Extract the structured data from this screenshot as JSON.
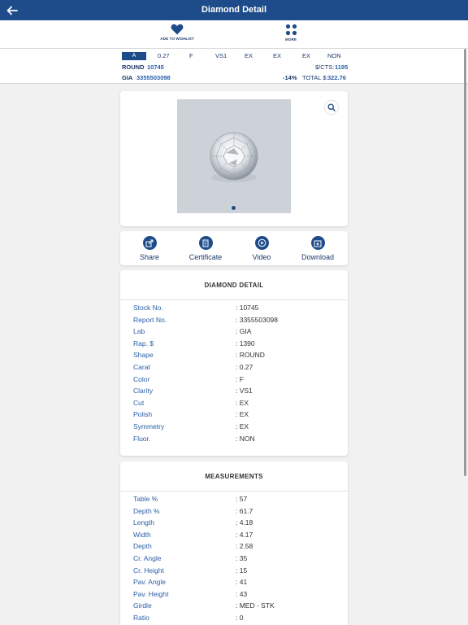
{
  "header": {
    "title": "Diamond Detail"
  },
  "actions": {
    "wishlist_label": "ADD TO WISHLIST",
    "more_label": "MORE"
  },
  "summary": {
    "grade": "A",
    "carat": "0.27",
    "color": "F",
    "clarity": "VS1",
    "cut": "EX",
    "polish": "EX",
    "symmetry": "EX",
    "fluor": "NON",
    "shape": "ROUND",
    "stock_no": "10745",
    "lab": "GIA",
    "report_no": "3355503098",
    "price_per_cts_label": "$/CTS:",
    "price_per_cts": "1195",
    "discount": "-14%",
    "total_label": "TOTAL $:",
    "total": "322.76"
  },
  "tools": [
    {
      "label": "Share"
    },
    {
      "label": "Certificate"
    },
    {
      "label": "Video"
    },
    {
      "label": "Download"
    }
  ],
  "diamond_detail": {
    "title": "DIAMOND DETAIL",
    "rows": [
      {
        "key": "Stock No.",
        "value": ": 10745"
      },
      {
        "key": "Report No.",
        "value": ": 3355503098"
      },
      {
        "key": "Lab",
        "value": ": GIA"
      },
      {
        "key": "Rap. $",
        "value": ": 1390"
      },
      {
        "key": "Shape",
        "value": ": ROUND"
      },
      {
        "key": "Carat",
        "value": ": 0.27"
      },
      {
        "key": "Color",
        "value": ": F"
      },
      {
        "key": "Clarity",
        "value": ": VS1"
      },
      {
        "key": "Cut",
        "value": ": EX"
      },
      {
        "key": "Polish",
        "value": ": EX"
      },
      {
        "key": "Symmetry",
        "value": ": EX"
      },
      {
        "key": "Fluor.",
        "value": ": NON"
      }
    ]
  },
  "measurements": {
    "title": "MEASUREMENTS",
    "rows": [
      {
        "key": "Table %",
        "value": ": 57"
      },
      {
        "key": "Depth %",
        "value": ": 61.7"
      },
      {
        "key": "Length",
        "value": ": 4.18"
      },
      {
        "key": "Width",
        "value": ": 4.17"
      },
      {
        "key": "Depth",
        "value": ": 2.58"
      },
      {
        "key": "Cr. Angle",
        "value": ": 35"
      },
      {
        "key": "Cr. Height",
        "value": ": 15"
      },
      {
        "key": "Pav. Angle",
        "value": ": 41"
      },
      {
        "key": "Pav. Height",
        "value": ": 43"
      },
      {
        "key": "Girdle",
        "value": ": MED - STK"
      },
      {
        "key": "Ratio",
        "value": ": 0"
      }
    ]
  }
}
